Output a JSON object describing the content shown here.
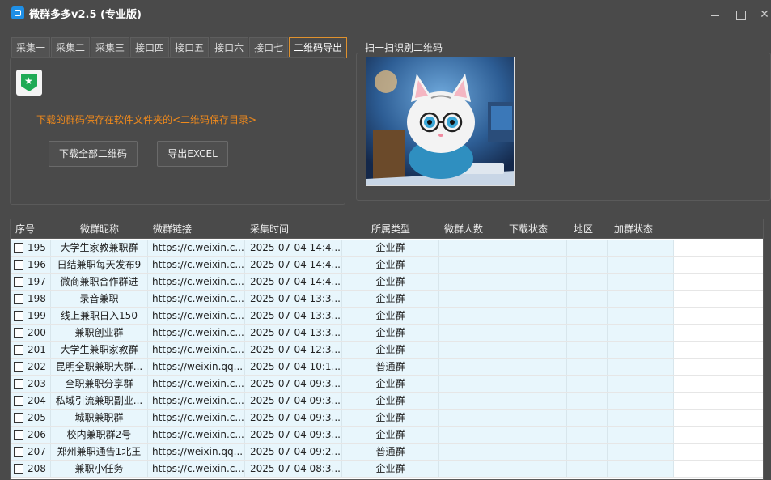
{
  "app": {
    "title": "微群多多v2.5 (专业版)"
  },
  "tabs": [
    {
      "label": "采集一",
      "active": false
    },
    {
      "label": "采集二",
      "active": false
    },
    {
      "label": "采集三",
      "active": false
    },
    {
      "label": "接口四",
      "active": false
    },
    {
      "label": "接口五",
      "active": false
    },
    {
      "label": "接口六",
      "active": false
    },
    {
      "label": "接口七",
      "active": false
    },
    {
      "label": "二维码导出",
      "active": true
    }
  ],
  "export_panel": {
    "notice": "下载的群码保存在软件文件夹的<二维码保存目录>",
    "download_all_label": "下载全部二维码",
    "export_excel_label": "导出EXCEL"
  },
  "qr_panel": {
    "title": "扫一扫识别二维码"
  },
  "table": {
    "columns": [
      "序号",
      "微群昵称",
      "微群链接",
      "采集时间",
      "所属类型",
      "微群人数",
      "下载状态",
      "地区",
      "加群状态"
    ],
    "rows": [
      {
        "no": "195",
        "name": "大学生家教兼职群",
        "link": "https://c.weixin.c...",
        "time": "2025-07-04 14:4...",
        "type": "企业群"
      },
      {
        "no": "196",
        "name": "日结兼职每天发布9",
        "link": "https://c.weixin.c...",
        "time": "2025-07-04 14:4...",
        "type": "企业群"
      },
      {
        "no": "197",
        "name": "微商兼职合作群进",
        "link": "https://c.weixin.c...",
        "time": "2025-07-04 14:4...",
        "type": "企业群"
      },
      {
        "no": "198",
        "name": "录音兼职",
        "link": "https://c.weixin.c...",
        "time": "2025-07-04 13:3...",
        "type": "企业群"
      },
      {
        "no": "199",
        "name": "线上兼职日入150",
        "link": "https://c.weixin.c...",
        "time": "2025-07-04 13:3...",
        "type": "企业群"
      },
      {
        "no": "200",
        "name": "兼职创业群",
        "link": "https://c.weixin.c...",
        "time": "2025-07-04 13:3...",
        "type": "企业群"
      },
      {
        "no": "201",
        "name": "大学生兼职家教群",
        "link": "https://c.weixin.c...",
        "time": "2025-07-04 12:3...",
        "type": "企业群"
      },
      {
        "no": "202",
        "name": "昆明全职兼职大群...",
        "link": "https://weixin.qq....",
        "time": "2025-07-04 10:1...",
        "type": "普通群"
      },
      {
        "no": "203",
        "name": "全职兼职分享群",
        "link": "https://c.weixin.c...",
        "time": "2025-07-04 09:3...",
        "type": "企业群"
      },
      {
        "no": "204",
        "name": "私域引流兼职副业...",
        "link": "https://c.weixin.c...",
        "time": "2025-07-04 09:3...",
        "type": "企业群"
      },
      {
        "no": "205",
        "name": "城职兼职群",
        "link": "https://c.weixin.c...",
        "time": "2025-07-04 09:3...",
        "type": "企业群"
      },
      {
        "no": "206",
        "name": "校内兼职群2号",
        "link": "https://c.weixin.c...",
        "time": "2025-07-04 09:3...",
        "type": "企业群"
      },
      {
        "no": "207",
        "name": "郑州兼职通告1北王",
        "link": "https://weixin.qq....",
        "time": "2025-07-04 09:2...",
        "type": "普通群"
      },
      {
        "no": "208",
        "name": "兼职小任务",
        "link": "https://c.weixin.c...",
        "time": "2025-07-04 08:3...",
        "type": "企业群"
      }
    ]
  }
}
